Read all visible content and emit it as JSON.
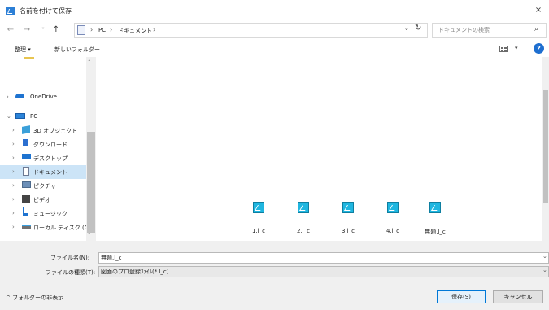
{
  "window": {
    "title": "名前を付けて保存",
    "close_glyph": "×"
  },
  "nav_buttons": {
    "back": "←",
    "forward": "→",
    "recent": "˅",
    "up": "↑"
  },
  "address": {
    "segments": [
      "PC",
      "ドキュメント"
    ],
    "separator": "›",
    "dropdown": "⌄",
    "refresh": "↻"
  },
  "search": {
    "placeholder": "ドキュメントの検索",
    "icon": "⌕"
  },
  "toolbar": {
    "organize": "整理 ▾",
    "new_folder": "新しいフォルダー",
    "view_caret": "▾",
    "help": "?"
  },
  "nav_pane": {
    "items": [
      {
        "label": "OneDrive",
        "icon": "cloud-icon",
        "chevron": "›"
      },
      {
        "label": "PC",
        "icon": "pc-icon",
        "chevron": "⌄"
      },
      {
        "label": "3D オブジェクト",
        "icon": "cube-icon",
        "chevron": "›"
      },
      {
        "label": "ダウンロード",
        "icon": "download-icon",
        "chevron": "›"
      },
      {
        "label": "デスクトップ",
        "icon": "desktop-icon",
        "chevron": "›"
      },
      {
        "label": "ドキュメント",
        "icon": "document-icon",
        "chevron": "›"
      },
      {
        "label": "ピクチャ",
        "icon": "picture-icon",
        "chevron": "›"
      },
      {
        "label": "ビデオ",
        "icon": "video-icon",
        "chevron": "›"
      },
      {
        "label": "ミュージック",
        "icon": "music-icon",
        "chevron": "›"
      },
      {
        "label": "ローカル ディスク (C",
        "icon": "disk-icon",
        "chevron": "›"
      }
    ],
    "scroll_up": "˄",
    "scroll_down": "˅"
  },
  "files": [
    {
      "name": "1.l_c"
    },
    {
      "name": "2.l_c"
    },
    {
      "name": "3.l_c"
    },
    {
      "name": "4.l_c"
    },
    {
      "name": "無題.l_c"
    }
  ],
  "fields": {
    "filename_label": "ファイル名(N):",
    "filename_value": "無題.l_c",
    "filetype_label": "ファイルの種類(T):",
    "filetype_value": "図面のプロ登録ﾌｧｲﾙ(*.l_c)",
    "caret": "⌄"
  },
  "footer": {
    "hide_folders": "^ フォルダーの非表示",
    "save": "保存(S)",
    "cancel": "キャンセル"
  },
  "colors": {
    "selected_nav": "#cce4f7",
    "file_icon": "#1fb6e0",
    "help": "#1e6fd0"
  }
}
